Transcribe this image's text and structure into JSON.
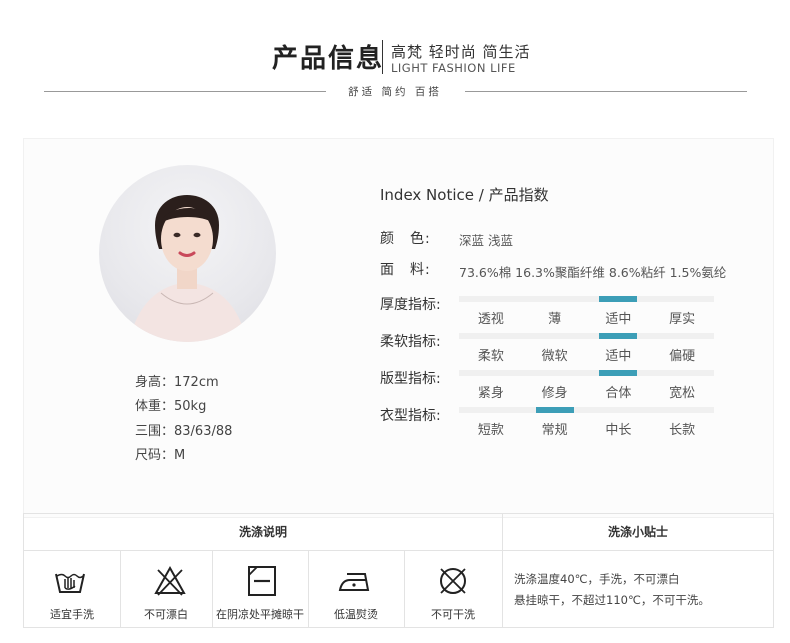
{
  "header": {
    "title": "产品信息",
    "tagline_cn": "高梵 轻时尚 简生活",
    "tagline_en": "LIGHT FASHION LIFE",
    "divider_text": "舒适 简约 百搭"
  },
  "model": {
    "height": "身高：172cm",
    "weight": "体重：50kg",
    "measurements": "三围：83/63/88",
    "size": "尺码：M"
  },
  "index": {
    "title": "Index Notice / 产品指数",
    "color_label": "颜　色:",
    "color_value": "深蓝 浅蓝",
    "fabric_label": "面　料:",
    "fabric_value": "73.6%棉 16.3%聚酯纤维 8.6%粘纤 1.5%氨纶",
    "indicators": [
      {
        "label": "厚度指标:",
        "options": [
          "透视",
          "薄",
          "适中",
          "厚实"
        ],
        "selected": 2
      },
      {
        "label": "柔软指标:",
        "options": [
          "柔软",
          "微软",
          "适中",
          "偏硬"
        ],
        "selected": 2
      },
      {
        "label": "版型指标:",
        "options": [
          "紧身",
          "修身",
          "合体",
          "宽松"
        ],
        "selected": 2
      },
      {
        "label": "衣型指标:",
        "options": [
          "短款",
          "常规",
          "中长",
          "长款"
        ],
        "selected": 1
      }
    ],
    "highlight_color": "#3c9eb7"
  },
  "wash": {
    "header_left": "洗涤说明",
    "header_right": "洗涤小贴士",
    "items": [
      {
        "icon": "hand-wash-icon",
        "label": "适宜手洗"
      },
      {
        "icon": "no-bleach-icon",
        "label": "不可漂白"
      },
      {
        "icon": "dry-flat-shade-icon",
        "label": "在阴凉处平摊晾干"
      },
      {
        "icon": "low-iron-icon",
        "label": "低温熨烫"
      },
      {
        "icon": "no-dry-clean-icon",
        "label": "不可干洗"
      }
    ],
    "tips_line1": "洗涤温度40℃，手洗，不可漂白",
    "tips_line2": "悬挂晾干，不超过110℃，不可干洗。"
  }
}
